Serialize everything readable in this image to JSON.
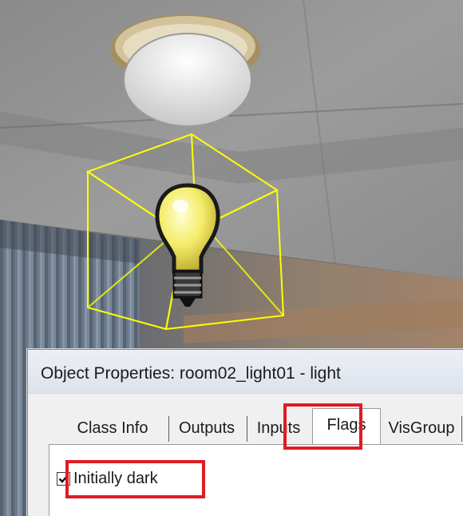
{
  "window": {
    "title": "Object Properties: room02_light01 - light"
  },
  "tabs": [
    {
      "label": "Class Info",
      "selected": false
    },
    {
      "label": "Outputs",
      "selected": false
    },
    {
      "label": "Inputs",
      "selected": false
    },
    {
      "label": "Flags",
      "selected": true
    },
    {
      "label": "VisGroup",
      "selected": false
    }
  ],
  "flags": [
    {
      "label": "Initially dark",
      "checked": true
    }
  ],
  "annotations": {
    "highlight_color": "#e01b24",
    "selection_box_color": "#ffff00"
  },
  "icons": {
    "light_entity": "light-bulb-icon",
    "checkmark": "checkmark-icon"
  }
}
